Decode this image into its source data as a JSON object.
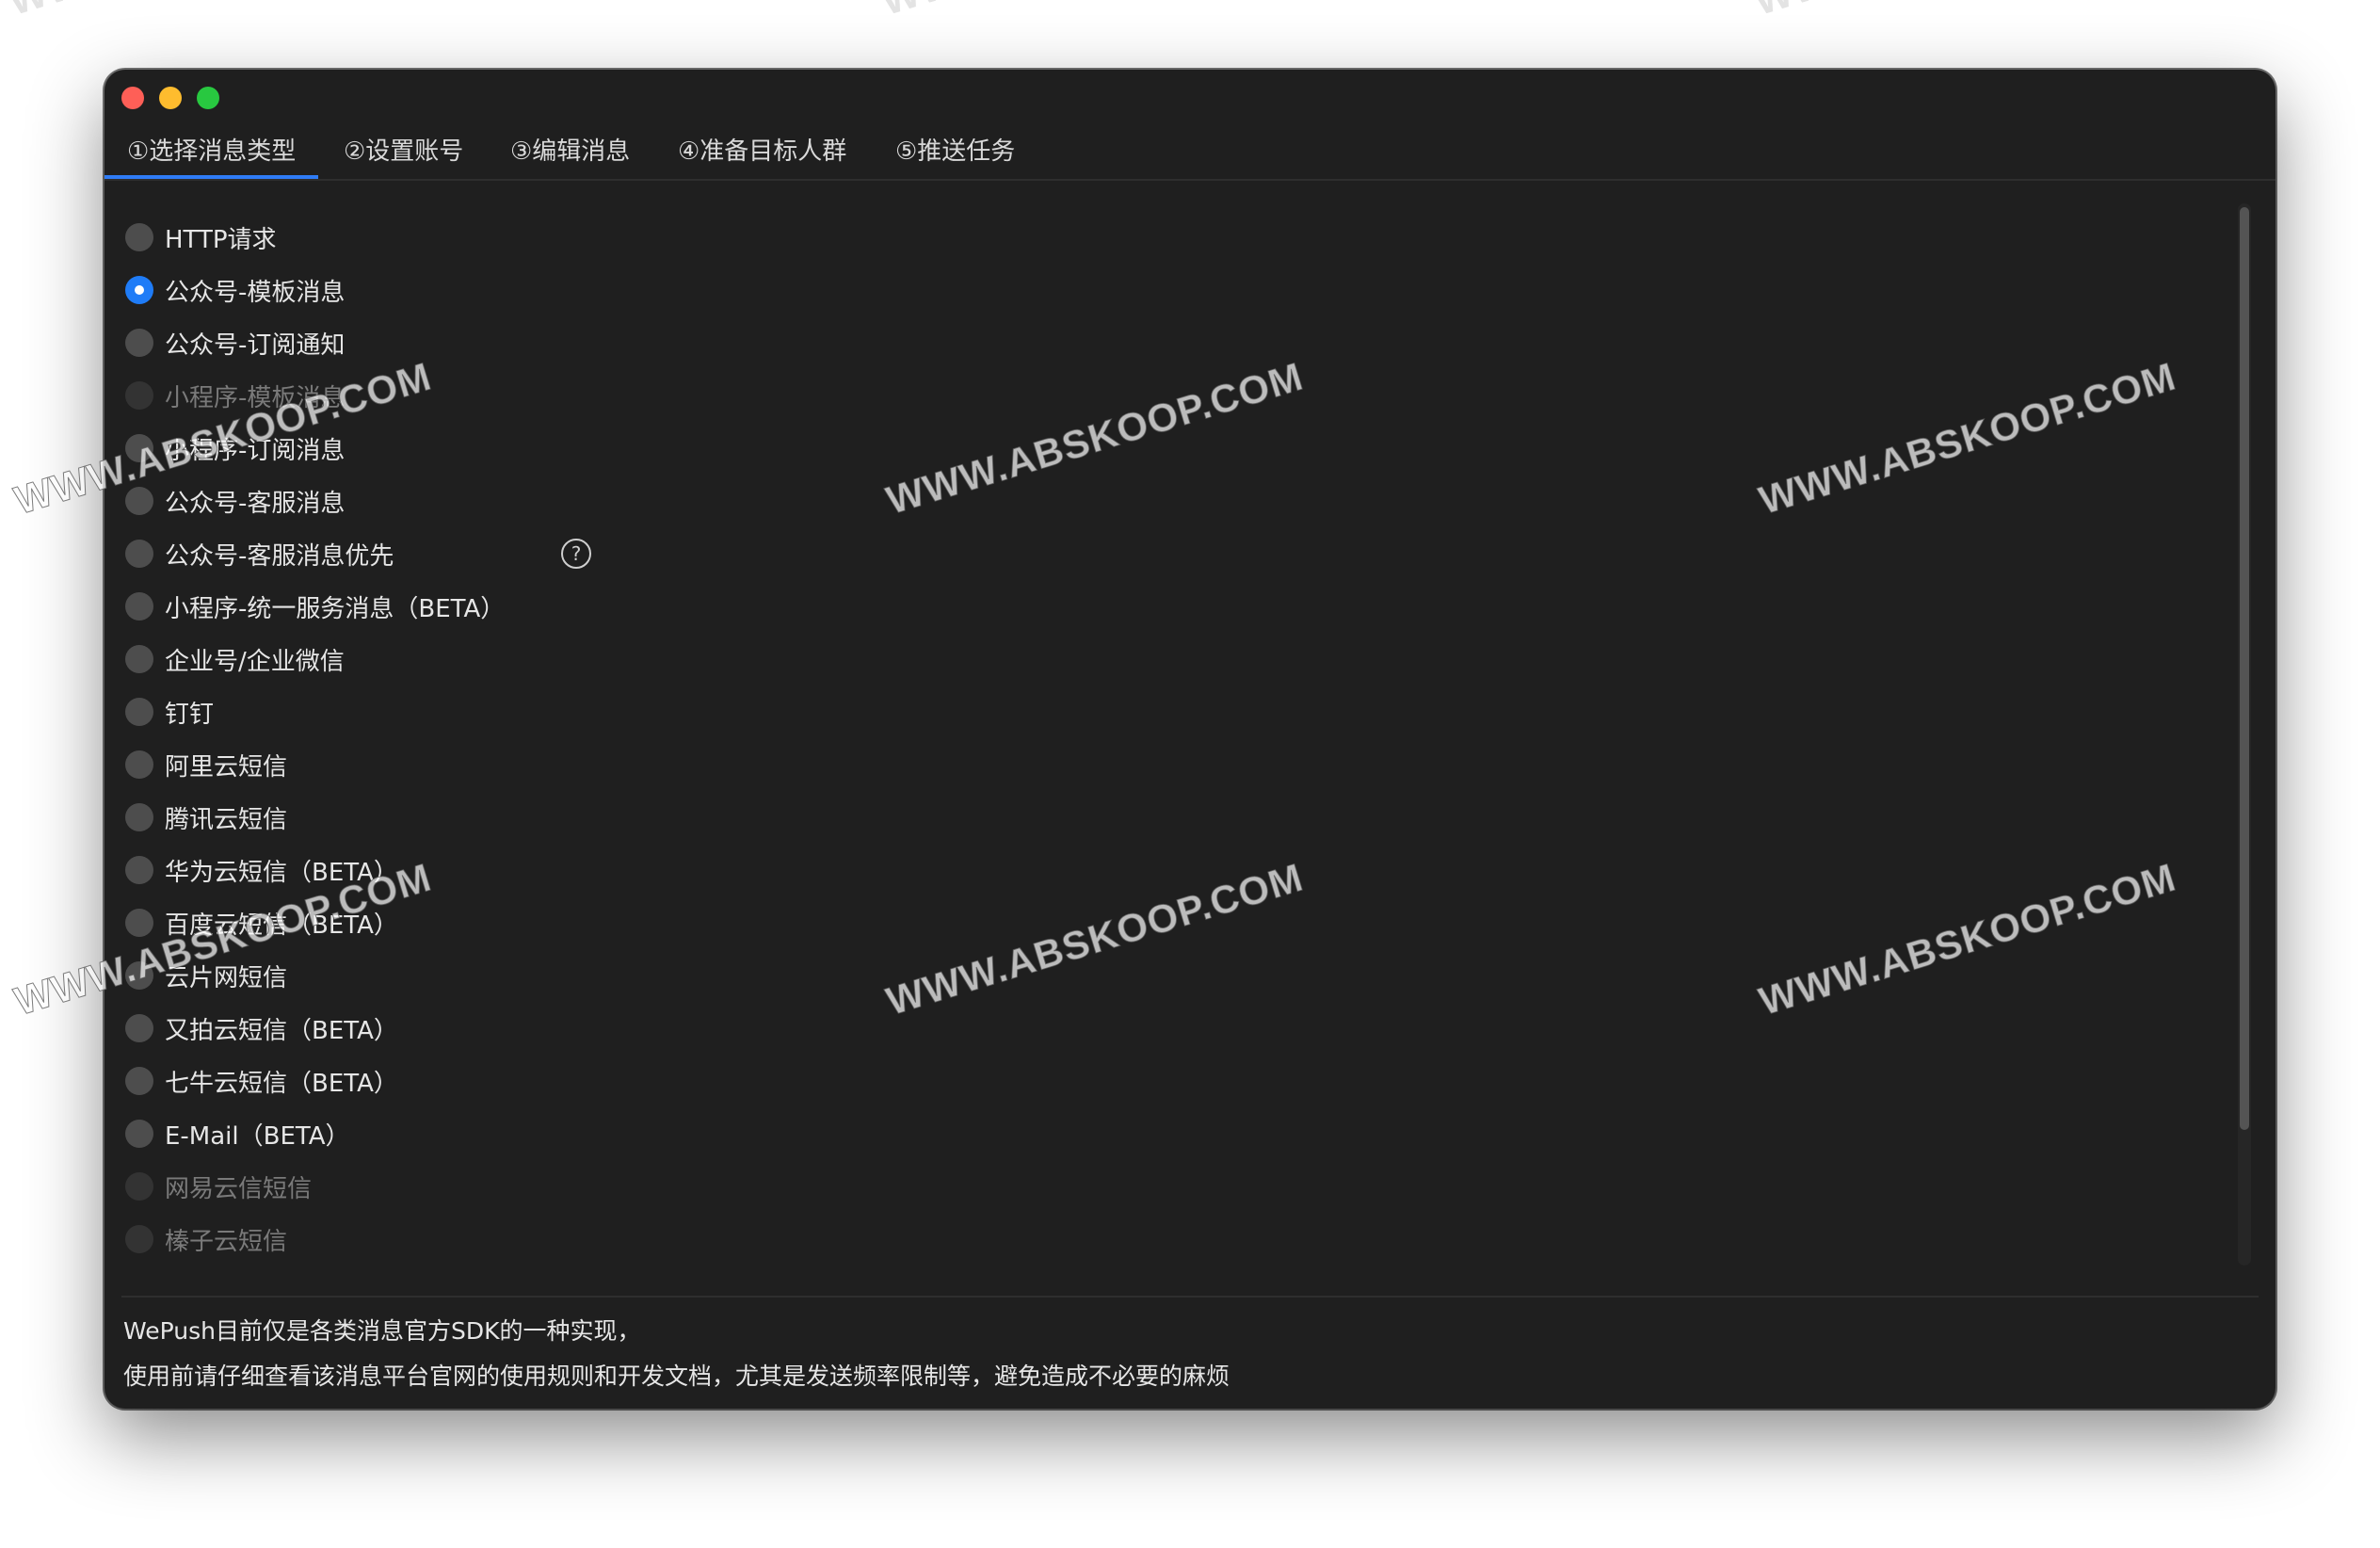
{
  "window": {
    "traffic_colors": [
      "#fe5f57",
      "#febc2e",
      "#28c840"
    ]
  },
  "tabs": [
    {
      "label": "①选择消息类型",
      "active": true
    },
    {
      "label": "②设置账号",
      "active": false
    },
    {
      "label": "③编辑消息",
      "active": false
    },
    {
      "label": "④准备目标人群",
      "active": false
    },
    {
      "label": "⑤推送任务",
      "active": false
    }
  ],
  "options": [
    {
      "label": "HTTP请求",
      "selected": false,
      "disabled": false
    },
    {
      "label": "公众号-模板消息",
      "selected": true,
      "disabled": false
    },
    {
      "label": "公众号-订阅通知",
      "selected": false,
      "disabled": false
    },
    {
      "label": "小程序-模板消息",
      "selected": false,
      "disabled": true
    },
    {
      "label": "小程序-订阅消息",
      "selected": false,
      "disabled": false
    },
    {
      "label": "公众号-客服消息",
      "selected": false,
      "disabled": false
    },
    {
      "label": "公众号-客服消息优先",
      "selected": false,
      "disabled": false,
      "help": "?"
    },
    {
      "label": "小程序-统一服务消息（BETA）",
      "selected": false,
      "disabled": false
    },
    {
      "label": "企业号/企业微信",
      "selected": false,
      "disabled": false
    },
    {
      "label": "钉钉",
      "selected": false,
      "disabled": false
    },
    {
      "label": "阿里云短信",
      "selected": false,
      "disabled": false
    },
    {
      "label": "腾讯云短信",
      "selected": false,
      "disabled": false
    },
    {
      "label": "华为云短信（BETA）",
      "selected": false,
      "disabled": false
    },
    {
      "label": "百度云短信（BETA）",
      "selected": false,
      "disabled": false
    },
    {
      "label": "云片网短信",
      "selected": false,
      "disabled": false
    },
    {
      "label": "又拍云短信（BETA）",
      "selected": false,
      "disabled": false
    },
    {
      "label": "七牛云短信（BETA）",
      "selected": false,
      "disabled": false
    },
    {
      "label": "E-Mail（BETA）",
      "selected": false,
      "disabled": false
    },
    {
      "label": "网易云信短信",
      "selected": false,
      "disabled": true
    },
    {
      "label": "榛子云短信",
      "selected": false,
      "disabled": true
    }
  ],
  "footer": {
    "line1": "WePush目前仅是各类消息官方SDK的一种实现，",
    "line2": "使用前请仔细查看该消息平台官网的使用规则和开发文档，尤其是发送频率限制等，避免造成不必要的麻烦"
  },
  "watermark": {
    "text": "WWW.ABSKOOP.COM",
    "top_fragment": "WW"
  }
}
